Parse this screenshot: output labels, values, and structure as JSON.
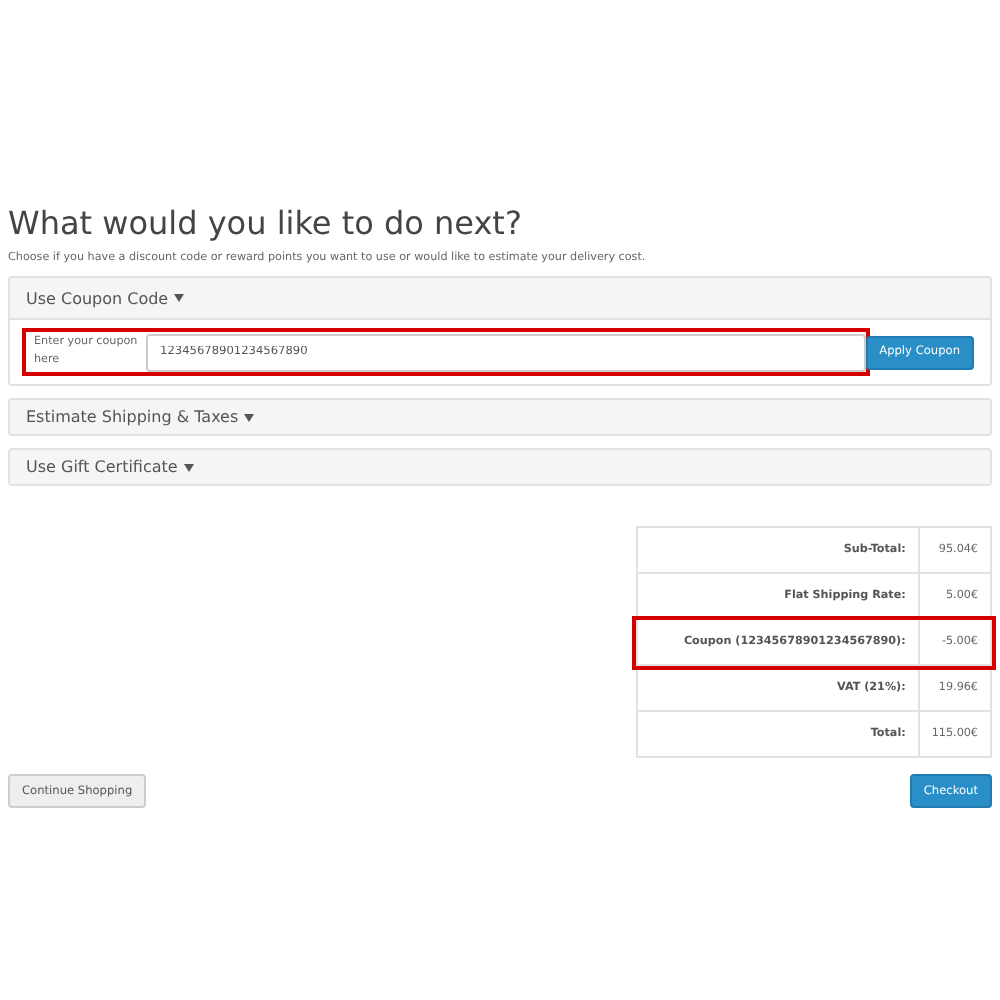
{
  "heading": "What would you like to do next?",
  "intro": "Choose if you have a discount code or reward points you want to use or would like to estimate your delivery cost.",
  "panels": [
    {
      "title": "Use Coupon Code",
      "expanded": true,
      "field_label": "Enter your coupon here",
      "field_value": "12345678901234567890",
      "button": "Apply Coupon",
      "highlighted": true
    },
    {
      "title": "Estimate Shipping & Taxes",
      "expanded": false
    },
    {
      "title": "Use Gift Certificate",
      "expanded": false
    }
  ],
  "totals": [
    {
      "label": "Sub-Total:",
      "value": "95.04€",
      "highlighted": false
    },
    {
      "label": "Flat Shipping Rate:",
      "value": "5.00€",
      "highlighted": false
    },
    {
      "label": "Coupon (12345678901234567890):",
      "value": "-5.00€",
      "highlighted": true
    },
    {
      "label": "VAT (21%):",
      "value": "19.96€",
      "highlighted": false
    },
    {
      "label": "Total:",
      "value": "115.00€",
      "highlighted": false
    }
  ],
  "buttons": [
    {
      "label": "Continue Shopping",
      "kind": "secondary"
    },
    {
      "label": "Checkout",
      "kind": "primary"
    }
  ]
}
